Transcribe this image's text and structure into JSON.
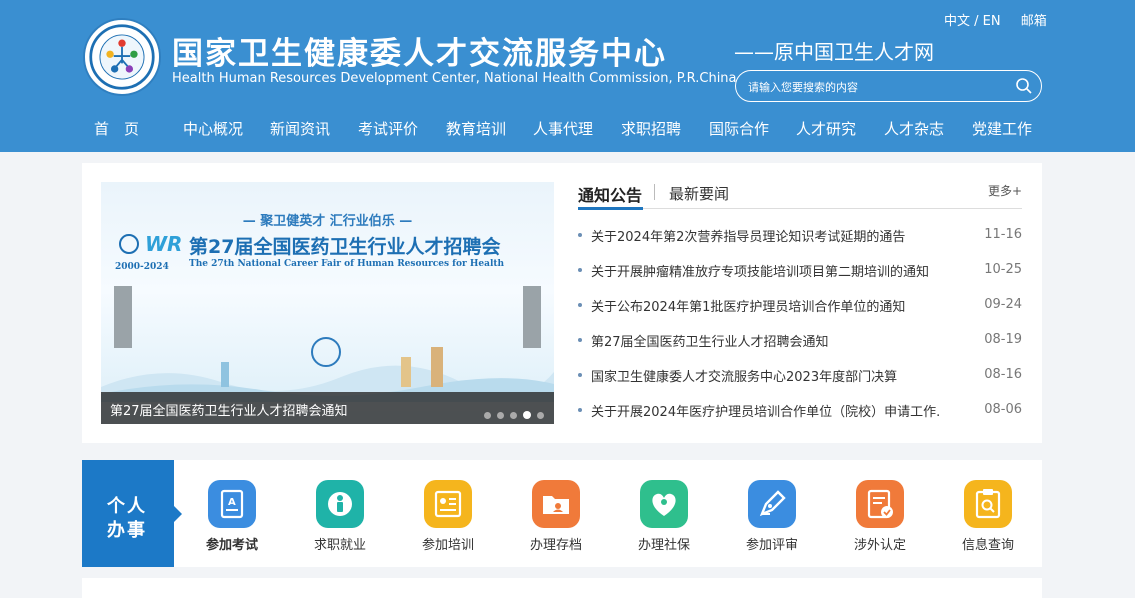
{
  "header": {
    "brand_cn": "国家卫生健康委人才交流服务中心",
    "brand_en": "Health Human Resources Development Center, National Health Commission, P.R.China",
    "brand_old": "——原中国卫生人才网",
    "lang": "中文 / EN",
    "mail": "邮箱",
    "search_placeholder": "请输入您要搜索的内容"
  },
  "nav": [
    "首　页",
    "中心概况",
    "新闻资讯",
    "考试评价",
    "教育培训",
    "人事代理",
    "求职招聘",
    "国际合作",
    "人才研究",
    "人才杂志",
    "党建工作"
  ],
  "banner": {
    "slogan": "— 聚卫健英才  汇行业伯乐 —",
    "title": "第27届全国医药卫生行业人才招聘会",
    "title_en": "The 27th National Career Fair of Human Resources for Health",
    "years": "2000-2024",
    "wr": "WR",
    "caption": "第27届全国医药卫生行业人才招聘会通知",
    "dots": 5,
    "active_dot": 3
  },
  "news": {
    "tab_active": "通知公告",
    "tab_inactive": "最新要闻",
    "more": "更多+",
    "items": [
      {
        "title": "关于2024年第2次营养指导员理论知识考试延期的通告",
        "date": "11-16"
      },
      {
        "title": "关于开展肿瘤精准放疗专项技能培训项目第二期培训的通知",
        "date": "10-25"
      },
      {
        "title": "关于公布2024年第1批医疗护理员培训合作单位的通知",
        "date": "09-24"
      },
      {
        "title": "第27届全国医药卫生行业人才招聘会通知",
        "date": "08-19"
      },
      {
        "title": "国家卫生健康委人才交流服务中心2023年度部门决算",
        "date": "08-16"
      },
      {
        "title": "关于开展2024年医疗护理员培训合作单位（院校）申请工作...",
        "date": "08-06"
      }
    ]
  },
  "service": {
    "label_line1": "个人",
    "label_line2": "办事",
    "items": [
      {
        "label": "参加考试",
        "icon": "exam-icon",
        "color": "#3b8de0"
      },
      {
        "label": "求职就业",
        "icon": "job-icon",
        "color": "#1fb3a8"
      },
      {
        "label": "参加培训",
        "icon": "training-icon",
        "color": "#f5b51d"
      },
      {
        "label": "办理存档",
        "icon": "archive-icon",
        "color": "#f07a3a"
      },
      {
        "label": "办理社保",
        "icon": "social-security-icon",
        "color": "#2fbf8d"
      },
      {
        "label": "参加评审",
        "icon": "review-icon",
        "color": "#3b8de0"
      },
      {
        "label": "涉外认定",
        "icon": "foreign-cert-icon",
        "color": "#f07a3a"
      },
      {
        "label": "信息查询",
        "icon": "info-query-icon",
        "color": "#f5b51d"
      }
    ]
  }
}
